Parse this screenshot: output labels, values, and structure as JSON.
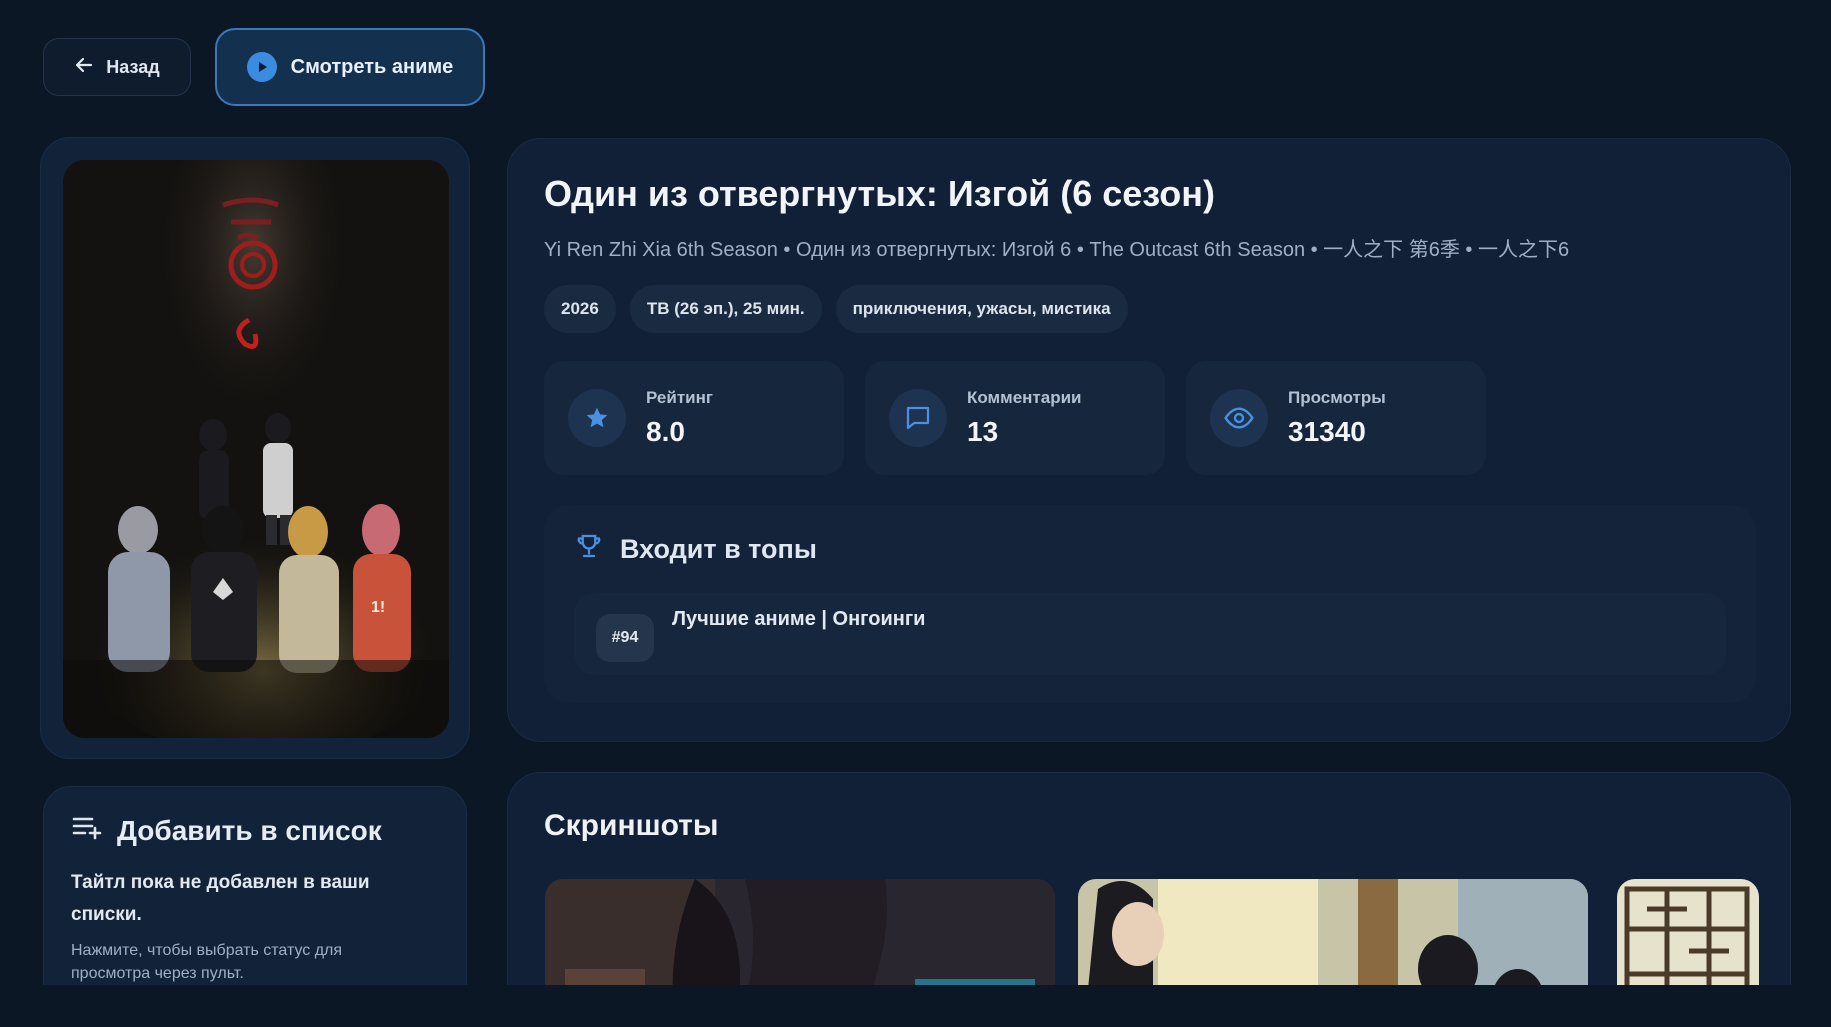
{
  "nav": {
    "back_label": "Назад",
    "watch_label": "Смотреть аниме"
  },
  "anime": {
    "title": "Один из отвергнутых: Изгой (6 сезон)",
    "alt_titles": "Yi Ren Zhi Xia 6th Season • Один из отвергнутых: Изгой 6 • The Outcast 6th Season • 一人之下 第6季 • 一人之下6",
    "chips": [
      "2026",
      "ТВ (26 эп.), 25 мин.",
      "приключения, ужасы, мистика"
    ]
  },
  "stats": [
    {
      "label": "Рейтинг",
      "value": "8.0",
      "icon": "star-icon"
    },
    {
      "label": "Комментарии",
      "value": "13",
      "icon": "comment-icon"
    },
    {
      "label": "Просмотры",
      "value": "31340",
      "icon": "eye-icon"
    }
  ],
  "tops": {
    "heading": "Входит в топы",
    "items": [
      {
        "rank": "#94",
        "label": "Лучшие аниме | Онгоинги"
      }
    ]
  },
  "list": {
    "heading": "Добавить в список",
    "status": "Тайтл пока не добавлен в ваши списки.",
    "hint": "Нажмите, чтобы выбрать статус для просмотра через пульт."
  },
  "screenshots": {
    "heading": "Скриншоты"
  },
  "colors": {
    "background": "#0c1726",
    "card": "#112036",
    "accent": "#3b8be0"
  }
}
